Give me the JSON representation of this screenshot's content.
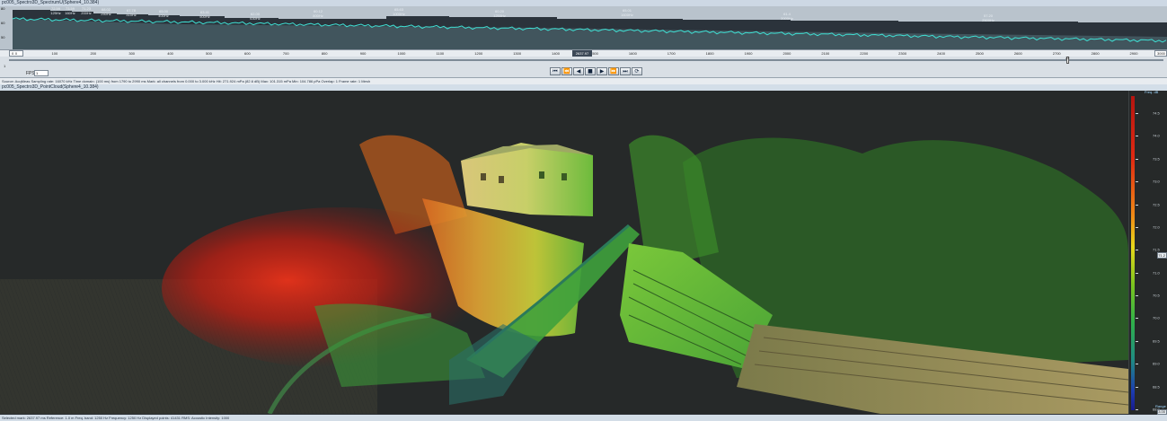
{
  "window": {
    "top_title": "pc005_Spectro3D_SpectrumU(Sphere4_10.384)",
    "mid_title": "pc005_Spectro3D_PointCloud(Sphere4_10.384)"
  },
  "spectrogram": {
    "y_ticks": [
      "80",
      "60",
      "50"
    ],
    "peaks": [
      {
        "level": "72.59",
        "freq": "125Hz"
      },
      {
        "level": "73.59",
        "freq": "160Hz"
      },
      {
        "level": "71.23",
        "freq": "200Hz"
      },
      {
        "level": "68.02",
        "freq": "250Hz"
      },
      {
        "level": "67.78",
        "freq": "315Hz"
      },
      {
        "level": "65.00",
        "freq": "400Hz"
      },
      {
        "level": "63.41",
        "freq": "500Hz"
      },
      {
        "level": "62.00",
        "freq": "630Hz"
      },
      {
        "level": "60.12",
        "freq": "800Hz"
      },
      {
        "level": "65.63",
        "freq": "1000Hz"
      },
      {
        "level": "60.20",
        "freq": "1250Hz"
      },
      {
        "level": "65.01",
        "freq": "1600Hz"
      },
      {
        "level": "61.4",
        "freq": "2000Hz"
      },
      {
        "level": "57.20",
        "freq": "2500Hz"
      }
    ],
    "trace_color": "#3fe0d4"
  },
  "time_axis": {
    "start_value": "0",
    "end_value": "3000",
    "cursor_value": "2637.97",
    "tick_labels": [
      "0",
      "100",
      "200",
      "300",
      "400",
      "500",
      "600",
      "700",
      "800",
      "900",
      "1000",
      "1100",
      "1200",
      "1300",
      "1400",
      "1500",
      "1600",
      "1700",
      "1800",
      "1900",
      "2000",
      "2100",
      "2200",
      "2300",
      "2400",
      "2500",
      "2600",
      "2700",
      "2800",
      "2900"
    ]
  },
  "scrollbar": {
    "value": "22"
  },
  "transport": {
    "rpm_label": "1",
    "fps_label": "FPS",
    "fps_value": "1",
    "buttons": [
      {
        "name": "go-start-button",
        "glyph": "⏮"
      },
      {
        "name": "step-back-button",
        "glyph": "⏪"
      },
      {
        "name": "play-reverse-button",
        "glyph": "◀"
      },
      {
        "name": "stop-button",
        "glyph": "■"
      },
      {
        "name": "play-button",
        "glyph": "▶"
      },
      {
        "name": "step-forward-button",
        "glyph": "⏩"
      },
      {
        "name": "go-end-button",
        "glyph": "⏭"
      },
      {
        "name": "loop-button",
        "glyph": "⟳"
      }
    ]
  },
  "info_bar": "Source: AcqMeas  Sampling rate: 16070 kHz  Time domain: (100 ms) from 1790 to 2990 ms  Mark: all channels  from 0.000 to 3.000 kHz  Hit: 271.924 mPa (82.6 dB)  Max: 101.315 mPa  Min: 104.786 pPa  Overlap: 1  Frame rate: 1  Mesh",
  "legend": {
    "title": "Freq. dB",
    "ticks": [
      "74.5",
      "74.0",
      "73.5",
      "73.0",
      "72.5",
      "72.0",
      "71.5",
      "71.0",
      "70.5",
      "70.0",
      "69.5",
      "69.0",
      "68.5",
      "68.0"
    ],
    "marker_value": "71.2",
    "bottom_label": "Range",
    "bottom_value": "3.00",
    "colors": [
      "#b51510",
      "#e02a12",
      "#f08a16",
      "#e8d81a",
      "#7cc41e",
      "#2fb04a",
      "#1f8b83",
      "#1c3cb0",
      "#181b8d"
    ]
  },
  "status_bar": "Selected mark: 2637.97 ms  Reference: 1.0 m  Freq. band: 1250 Hz  Frequency: 1250 Hz  Displayed points: 41431  RMS: Acoustic Intensity: 1000"
}
